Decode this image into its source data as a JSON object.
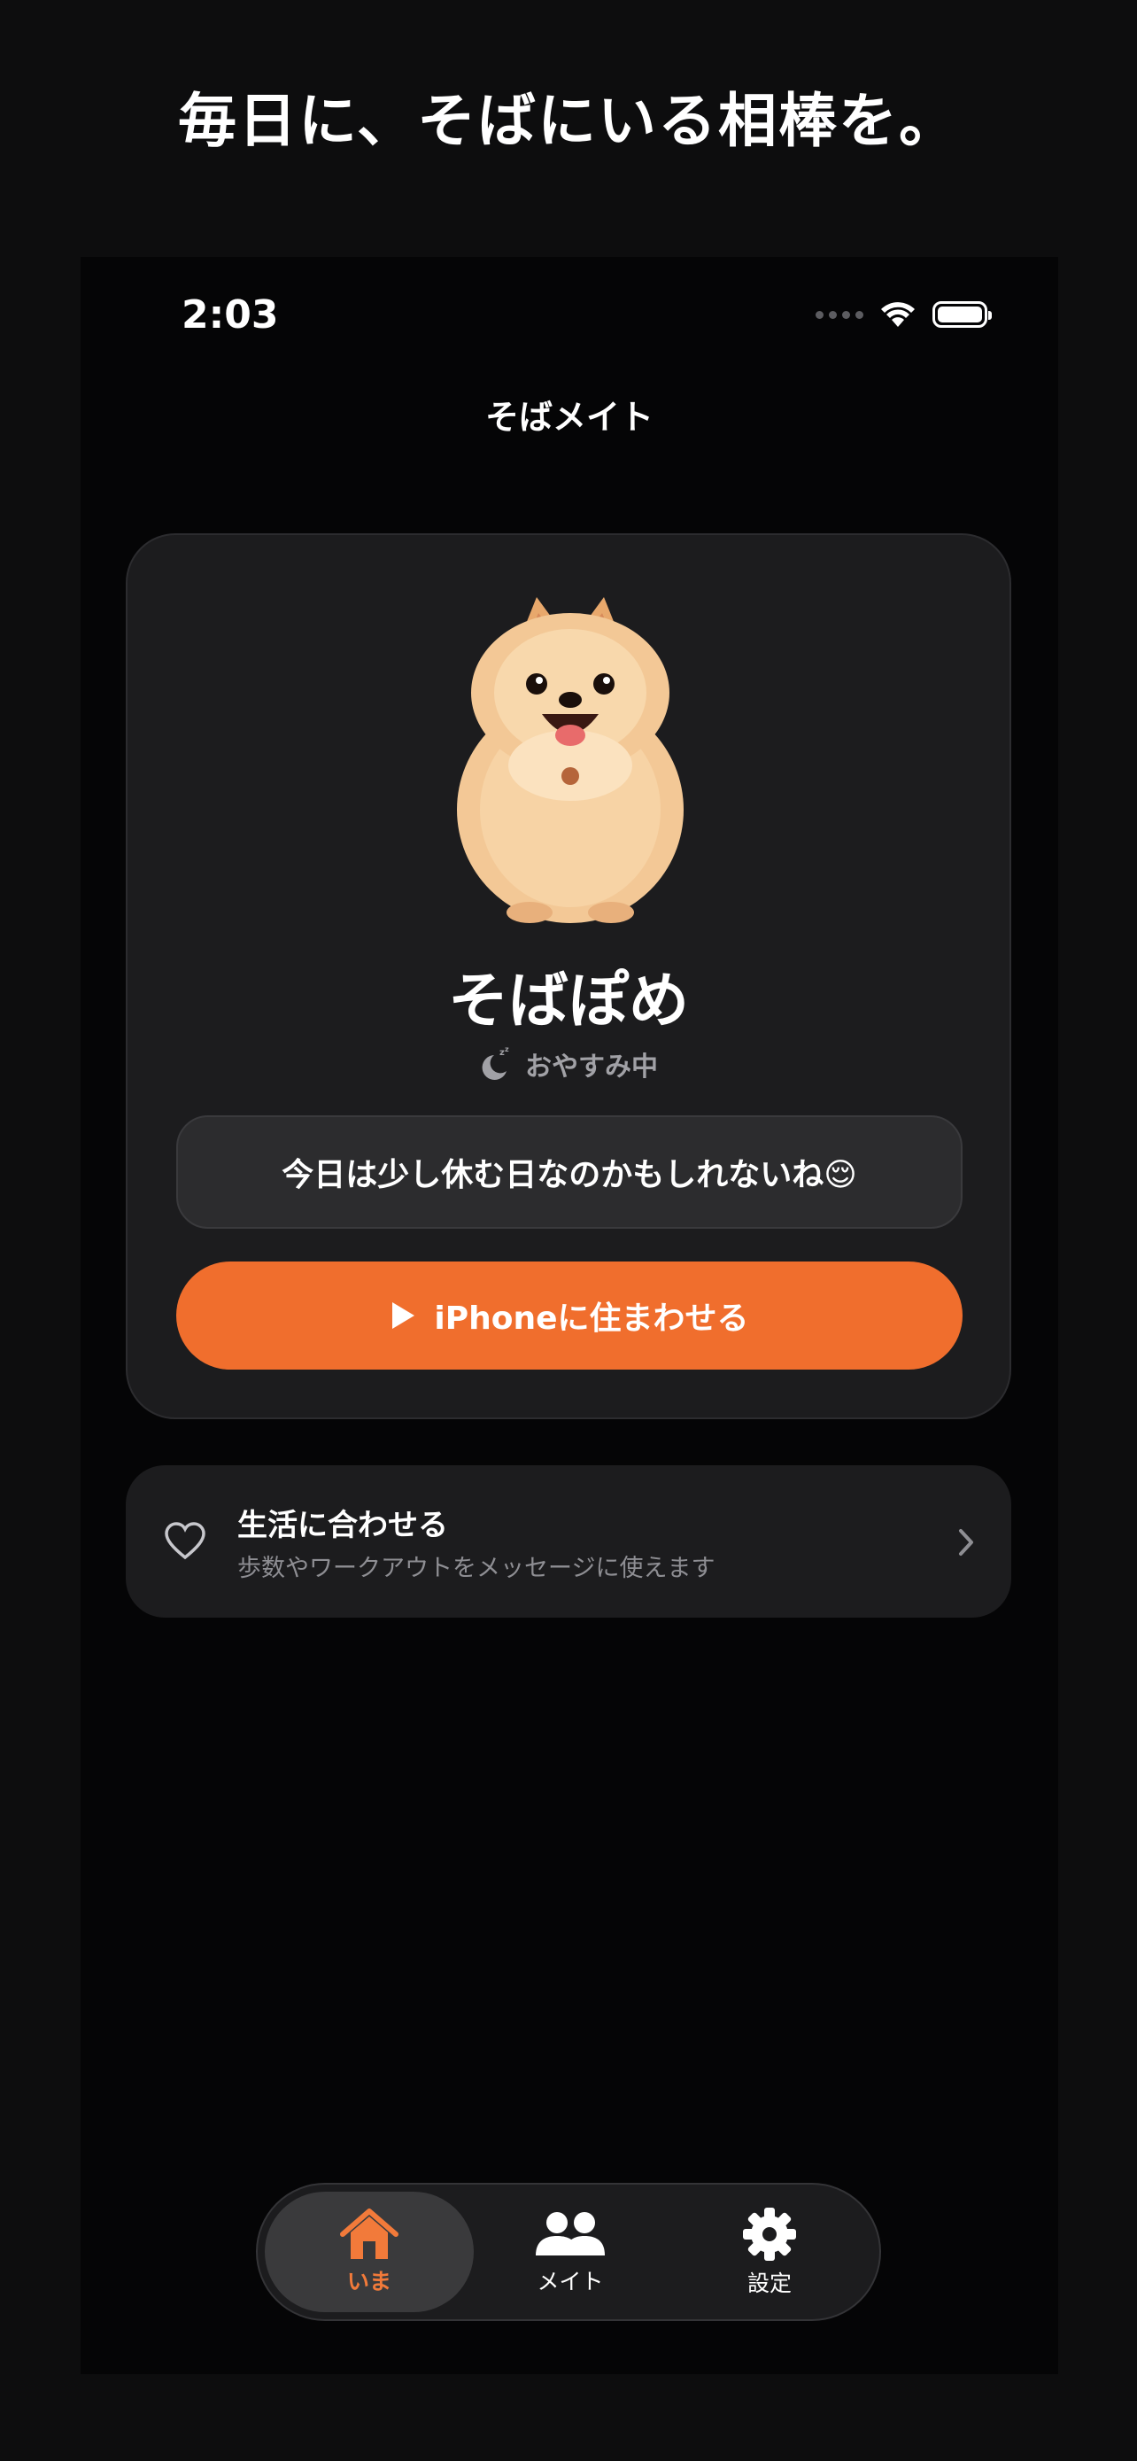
{
  "headline": "毎日に、そばにいる相棒を。",
  "status_bar": {
    "time": "2:03"
  },
  "nav": {
    "title": "そばメイト"
  },
  "pet": {
    "name": "そばぽめ",
    "status": "おやすみ中",
    "message": "今日は少し休む日なのかもしれないね😌",
    "action_label": "iPhoneに住まわせる"
  },
  "health": {
    "title": "生活に合わせる",
    "subtitle": "歩数やワークアウトをメッセージに使えます"
  },
  "tabs": [
    {
      "label": "いま",
      "icon": "house-icon",
      "selected": true
    },
    {
      "label": "メイト",
      "icon": "people-icon",
      "selected": false
    },
    {
      "label": "設定",
      "icon": "gear-icon",
      "selected": false
    }
  ],
  "colors": {
    "accent": "#f06e2d",
    "background": "#050506",
    "card": "#1c1c1e",
    "secondary_text": "#8e8e93"
  }
}
